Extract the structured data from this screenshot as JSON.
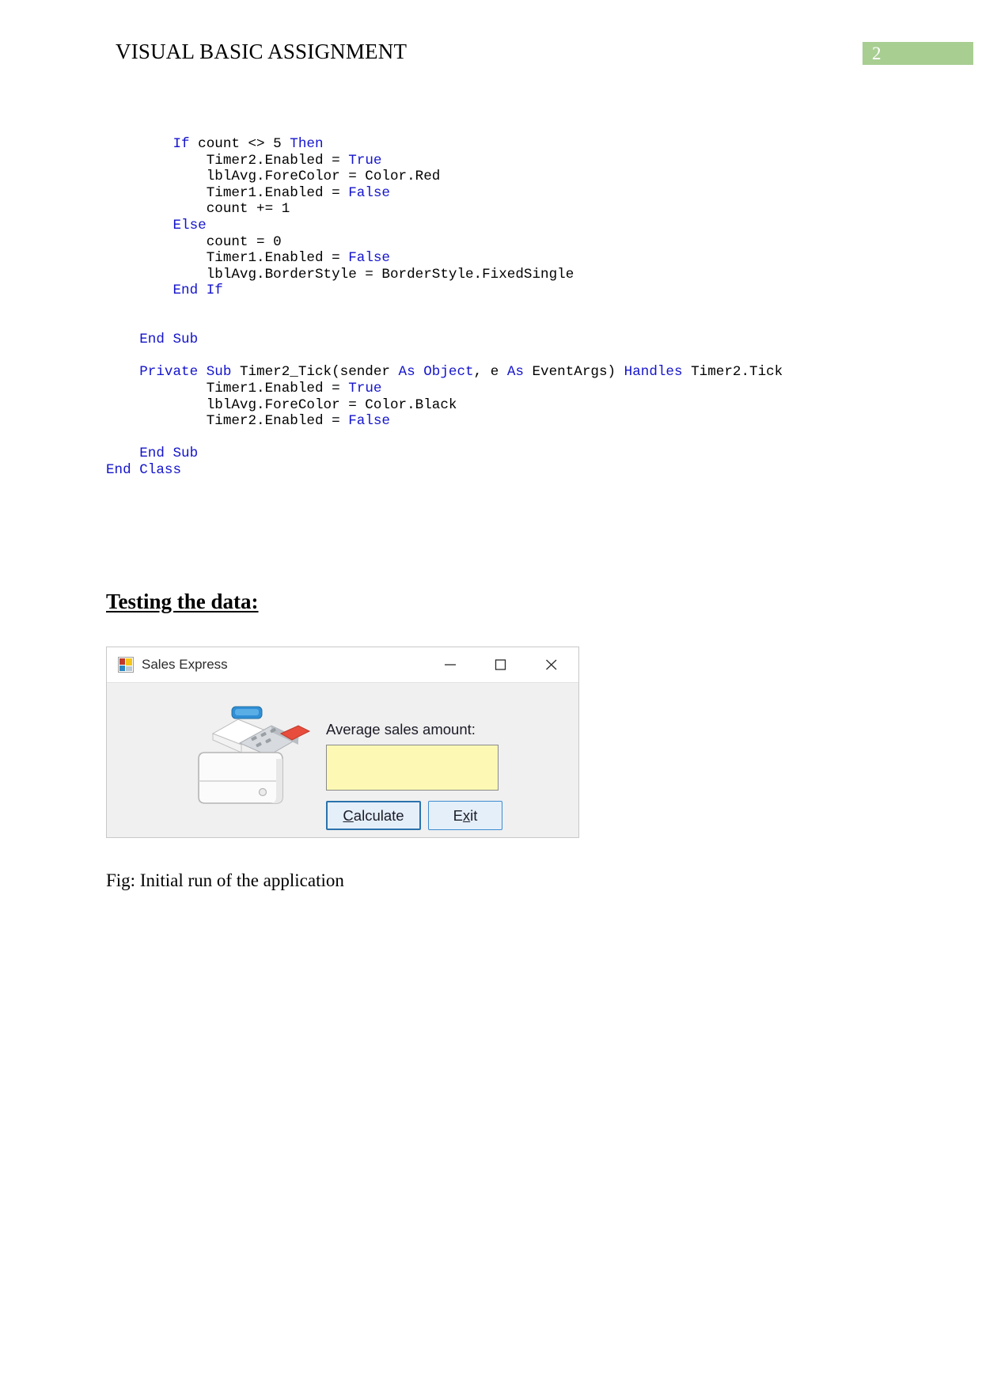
{
  "header": {
    "title": "VISUAL BASIC ASSIGNMENT",
    "page_number": "2",
    "badge_color": "#a8ce92"
  },
  "code": {
    "keyword_color": "#1414cc",
    "text_color": "#000000",
    "lines": [
      {
        "indent": 8,
        "parts": [
          {
            "t": "If ",
            "kw": true
          },
          {
            "t": "count <> 5 ",
            "kw": false
          },
          {
            "t": "Then",
            "kw": true
          }
        ]
      },
      {
        "indent": 12,
        "parts": [
          {
            "t": "Timer2.Enabled = ",
            "kw": false
          },
          {
            "t": "True",
            "kw": true
          }
        ]
      },
      {
        "indent": 12,
        "parts": [
          {
            "t": "lblAvg.ForeColor = Color.Red",
            "kw": false
          }
        ]
      },
      {
        "indent": 12,
        "parts": [
          {
            "t": "Timer1.Enabled = ",
            "kw": false
          },
          {
            "t": "False",
            "kw": true
          }
        ]
      },
      {
        "indent": 12,
        "parts": [
          {
            "t": "count += 1",
            "kw": false
          }
        ]
      },
      {
        "indent": 8,
        "parts": [
          {
            "t": "Else",
            "kw": true
          }
        ]
      },
      {
        "indent": 12,
        "parts": [
          {
            "t": "count = 0",
            "kw": false
          }
        ]
      },
      {
        "indent": 12,
        "parts": [
          {
            "t": "Timer1.Enabled = ",
            "kw": false
          },
          {
            "t": "False",
            "kw": true
          }
        ]
      },
      {
        "indent": 12,
        "parts": [
          {
            "t": "lblAvg.BorderStyle = BorderStyle.FixedSingle",
            "kw": false
          }
        ]
      },
      {
        "indent": 8,
        "parts": [
          {
            "t": "End If",
            "kw": true
          }
        ]
      },
      {
        "indent": 0,
        "parts": []
      },
      {
        "indent": 0,
        "parts": []
      },
      {
        "indent": 4,
        "parts": [
          {
            "t": "End Sub",
            "kw": true
          }
        ]
      },
      {
        "indent": 0,
        "parts": []
      },
      {
        "indent": 4,
        "parts": [
          {
            "t": "Private Sub ",
            "kw": true
          },
          {
            "t": "Timer2_Tick(sender ",
            "kw": false
          },
          {
            "t": "As Object",
            "kw": true
          },
          {
            "t": ", e ",
            "kw": false
          },
          {
            "t": "As ",
            "kw": true
          },
          {
            "t": "EventArgs) ",
            "kw": false
          },
          {
            "t": "Handles",
            "kw": true
          },
          {
            "t": " Timer2.Tick",
            "kw": false
          }
        ]
      },
      {
        "indent": 12,
        "parts": [
          {
            "t": "Timer1.Enabled = ",
            "kw": false
          },
          {
            "t": "True",
            "kw": true
          }
        ]
      },
      {
        "indent": 12,
        "parts": [
          {
            "t": "lblAvg.ForeColor = Color.Black",
            "kw": false
          }
        ]
      },
      {
        "indent": 12,
        "parts": [
          {
            "t": "Timer2.Enabled = ",
            "kw": false
          },
          {
            "t": "False",
            "kw": true
          }
        ]
      },
      {
        "indent": 0,
        "parts": []
      },
      {
        "indent": 4,
        "parts": [
          {
            "t": "End Sub",
            "kw": true
          }
        ]
      },
      {
        "indent": 0,
        "parts": [
          {
            "t": "End Class",
            "kw": true
          }
        ]
      }
    ]
  },
  "testing_section": {
    "heading": "Testing the data:"
  },
  "app_window": {
    "title": "Sales Express",
    "icon": "visual-basic-form-icon",
    "minimize_label": "Minimize",
    "maximize_label": "Maximize",
    "close_label": "Close",
    "label_average": "Average sales amount:",
    "textbox_value": "",
    "textbox_color": "#fdf9b5",
    "buttons": [
      {
        "name": "calculate",
        "accel": "C",
        "rest": "alculate",
        "focused": true
      },
      {
        "name": "exit",
        "pre": "E",
        "accel": "x",
        "rest": "it",
        "focused": false
      }
    ]
  },
  "figure": {
    "caption": "Fig: Initial run of the application"
  }
}
